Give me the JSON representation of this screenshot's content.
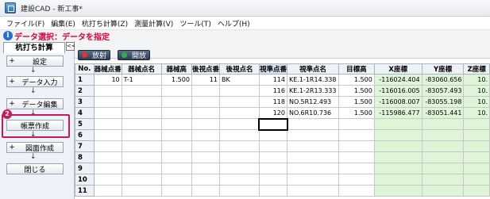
{
  "window": {
    "title": "建設CAD - 新工事*"
  },
  "menu": [
    "ファイル(F)",
    "編集(E)",
    "杭打ち計算(Z)",
    "測量計算(V)",
    "ツール(T)",
    "ヘルプ(H)"
  ],
  "mode": {
    "text": "データ選択：データを指定"
  },
  "sidebar": {
    "tab": "杭打ち計算",
    "collapse": "<<",
    "arrow": "↓",
    "badge": "2",
    "buttons": {
      "settings": "設定",
      "data_input": "データ入力",
      "data_edit": "データ編集",
      "report": "帳票作成",
      "drawing": "図面作成",
      "close": "閉じる"
    },
    "plus": "+"
  },
  "toolbar": {
    "release": "放射",
    "open": "開放"
  },
  "colors": {
    "accent": "#e0003c",
    "highlight": "#c8195a",
    "green_cells": "#dff5d8"
  },
  "table": {
    "headers": [
      "No.",
      "器械点番",
      "器械点名",
      "器械高",
      "後視点番",
      "後視点名",
      "視準点番",
      "視準点名",
      "目標高",
      "X座標",
      "Y座標",
      "Z座標"
    ],
    "rows": [
      [
        "1",
        "10",
        "T-1",
        "1.500",
        "11",
        "BK",
        "114",
        "KE.1-1R14.338",
        "1.500",
        "-116024.404",
        "-83060.656",
        "10."
      ],
      [
        "2",
        "",
        "",
        "",
        "",
        "",
        "116",
        "KE.1-2R13.333",
        "1.500",
        "-116016.005",
        "-83057.493",
        "10."
      ],
      [
        "3",
        "",
        "",
        "",
        "",
        "",
        "118",
        "NO.5R12.493",
        "1.500",
        "-116008.007",
        "-83055.198",
        "10."
      ],
      [
        "4",
        "",
        "",
        "",
        "",
        "",
        "120",
        "NO.6R10.736",
        "1.500",
        "-115986.477",
        "-83051.441",
        "10."
      ],
      [
        "5",
        "",
        "",
        "",
        "",
        "",
        "",
        "",
        "",
        "",
        "",
        ""
      ],
      [
        "6",
        "",
        "",
        "",
        "",
        "",
        "",
        "",
        "",
        "",
        "",
        ""
      ],
      [
        "7",
        "",
        "",
        "",
        "",
        "",
        "",
        "",
        "",
        "",
        "",
        ""
      ],
      [
        "8",
        "",
        "",
        "",
        "",
        "",
        "",
        "",
        "",
        "",
        "",
        ""
      ],
      [
        "9",
        "",
        "",
        "",
        "",
        "",
        "",
        "",
        "",
        "",
        "",
        ""
      ],
      [
        "10",
        "",
        "",
        "",
        "",
        "",
        "",
        "",
        "",
        "",
        "",
        ""
      ],
      [
        "11",
        "",
        "",
        "",
        "",
        "",
        "",
        "",
        "",
        "",
        "",
        ""
      ]
    ]
  }
}
